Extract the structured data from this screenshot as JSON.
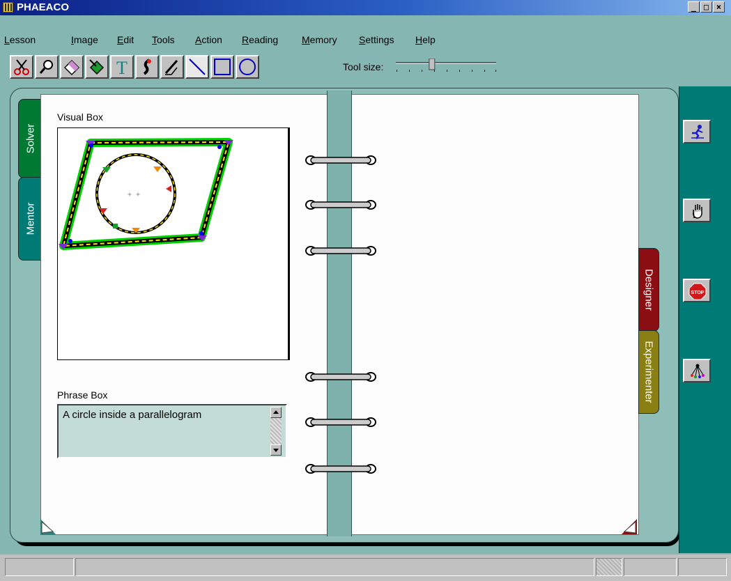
{
  "window": {
    "title": "PHAEACO",
    "min": "_",
    "max": "□",
    "close": "×"
  },
  "menu": [
    {
      "key": "L",
      "rest": "esson"
    },
    {
      "key": "I",
      "rest": "mage"
    },
    {
      "key": "E",
      "rest": "dit"
    },
    {
      "key": "T",
      "rest": "ools"
    },
    {
      "key": "A",
      "rest": "ction"
    },
    {
      "key": "R",
      "rest": "eading"
    },
    {
      "key": "M",
      "rest": "emory"
    },
    {
      "key": "S",
      "rest": "ettings"
    },
    {
      "key": "H",
      "rest": "elp"
    }
  ],
  "toolbar": {
    "tools": [
      "scissors-icon",
      "magnifier-icon",
      "eraser-icon",
      "fill-icon",
      "text-icon",
      "brush-icon",
      "pencil-icon",
      "line-icon",
      "rectangle-icon",
      "ellipse-icon"
    ],
    "tool_size_label": "Tool size:",
    "tool_size_value": 0.36
  },
  "notebook": {
    "left_tabs": [
      "Solver",
      "Mentor"
    ],
    "right_tabs": [
      "Designer",
      "Experimenter"
    ],
    "visual_box_label": "Visual Box",
    "phrase_box_label": "Phrase Box",
    "phrase_text": "A circle inside a parallelogram"
  },
  "right_panel": {
    "buttons": [
      "run-icon",
      "hand-icon",
      "stop-icon",
      "network-icon"
    ],
    "stop_text": "STOP"
  },
  "colors": {
    "solver_tab": "#007a33",
    "mentor_tab": "#007a74",
    "designer_tab": "#8b0f12",
    "experimenter_tab": "#8a7f12",
    "panel": "#007a74"
  }
}
